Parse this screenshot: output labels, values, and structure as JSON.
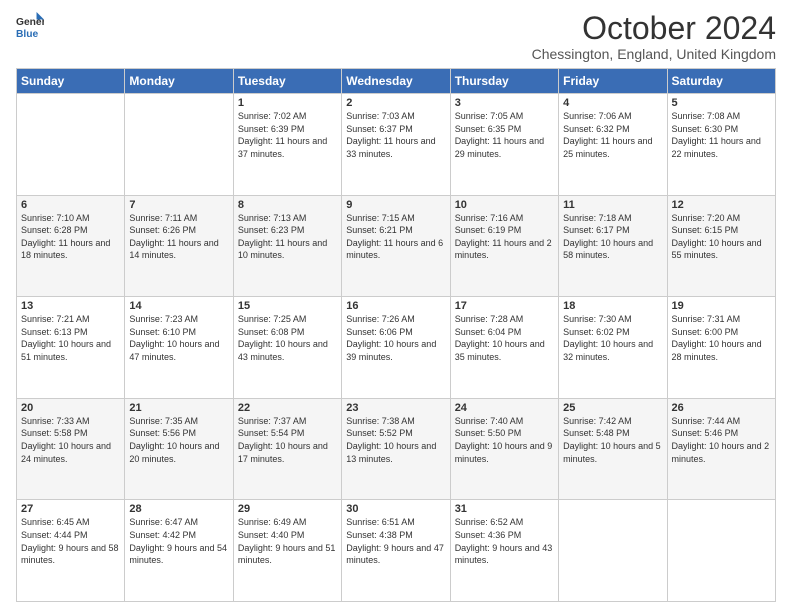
{
  "header": {
    "logo_line1": "General",
    "logo_line2": "Blue",
    "month": "October 2024",
    "location": "Chessington, England, United Kingdom"
  },
  "days_of_week": [
    "Sunday",
    "Monday",
    "Tuesday",
    "Wednesday",
    "Thursday",
    "Friday",
    "Saturday"
  ],
  "weeks": [
    [
      {
        "day": "",
        "sunrise": "",
        "sunset": "",
        "daylight": ""
      },
      {
        "day": "",
        "sunrise": "",
        "sunset": "",
        "daylight": ""
      },
      {
        "day": "1",
        "sunrise": "Sunrise: 7:02 AM",
        "sunset": "Sunset: 6:39 PM",
        "daylight": "Daylight: 11 hours and 37 minutes."
      },
      {
        "day": "2",
        "sunrise": "Sunrise: 7:03 AM",
        "sunset": "Sunset: 6:37 PM",
        "daylight": "Daylight: 11 hours and 33 minutes."
      },
      {
        "day": "3",
        "sunrise": "Sunrise: 7:05 AM",
        "sunset": "Sunset: 6:35 PM",
        "daylight": "Daylight: 11 hours and 29 minutes."
      },
      {
        "day": "4",
        "sunrise": "Sunrise: 7:06 AM",
        "sunset": "Sunset: 6:32 PM",
        "daylight": "Daylight: 11 hours and 25 minutes."
      },
      {
        "day": "5",
        "sunrise": "Sunrise: 7:08 AM",
        "sunset": "Sunset: 6:30 PM",
        "daylight": "Daylight: 11 hours and 22 minutes."
      }
    ],
    [
      {
        "day": "6",
        "sunrise": "Sunrise: 7:10 AM",
        "sunset": "Sunset: 6:28 PM",
        "daylight": "Daylight: 11 hours and 18 minutes."
      },
      {
        "day": "7",
        "sunrise": "Sunrise: 7:11 AM",
        "sunset": "Sunset: 6:26 PM",
        "daylight": "Daylight: 11 hours and 14 minutes."
      },
      {
        "day": "8",
        "sunrise": "Sunrise: 7:13 AM",
        "sunset": "Sunset: 6:23 PM",
        "daylight": "Daylight: 11 hours and 10 minutes."
      },
      {
        "day": "9",
        "sunrise": "Sunrise: 7:15 AM",
        "sunset": "Sunset: 6:21 PM",
        "daylight": "Daylight: 11 hours and 6 minutes."
      },
      {
        "day": "10",
        "sunrise": "Sunrise: 7:16 AM",
        "sunset": "Sunset: 6:19 PM",
        "daylight": "Daylight: 11 hours and 2 minutes."
      },
      {
        "day": "11",
        "sunrise": "Sunrise: 7:18 AM",
        "sunset": "Sunset: 6:17 PM",
        "daylight": "Daylight: 10 hours and 58 minutes."
      },
      {
        "day": "12",
        "sunrise": "Sunrise: 7:20 AM",
        "sunset": "Sunset: 6:15 PM",
        "daylight": "Daylight: 10 hours and 55 minutes."
      }
    ],
    [
      {
        "day": "13",
        "sunrise": "Sunrise: 7:21 AM",
        "sunset": "Sunset: 6:13 PM",
        "daylight": "Daylight: 10 hours and 51 minutes."
      },
      {
        "day": "14",
        "sunrise": "Sunrise: 7:23 AM",
        "sunset": "Sunset: 6:10 PM",
        "daylight": "Daylight: 10 hours and 47 minutes."
      },
      {
        "day": "15",
        "sunrise": "Sunrise: 7:25 AM",
        "sunset": "Sunset: 6:08 PM",
        "daylight": "Daylight: 10 hours and 43 minutes."
      },
      {
        "day": "16",
        "sunrise": "Sunrise: 7:26 AM",
        "sunset": "Sunset: 6:06 PM",
        "daylight": "Daylight: 10 hours and 39 minutes."
      },
      {
        "day": "17",
        "sunrise": "Sunrise: 7:28 AM",
        "sunset": "Sunset: 6:04 PM",
        "daylight": "Daylight: 10 hours and 35 minutes."
      },
      {
        "day": "18",
        "sunrise": "Sunrise: 7:30 AM",
        "sunset": "Sunset: 6:02 PM",
        "daylight": "Daylight: 10 hours and 32 minutes."
      },
      {
        "day": "19",
        "sunrise": "Sunrise: 7:31 AM",
        "sunset": "Sunset: 6:00 PM",
        "daylight": "Daylight: 10 hours and 28 minutes."
      }
    ],
    [
      {
        "day": "20",
        "sunrise": "Sunrise: 7:33 AM",
        "sunset": "Sunset: 5:58 PM",
        "daylight": "Daylight: 10 hours and 24 minutes."
      },
      {
        "day": "21",
        "sunrise": "Sunrise: 7:35 AM",
        "sunset": "Sunset: 5:56 PM",
        "daylight": "Daylight: 10 hours and 20 minutes."
      },
      {
        "day": "22",
        "sunrise": "Sunrise: 7:37 AM",
        "sunset": "Sunset: 5:54 PM",
        "daylight": "Daylight: 10 hours and 17 minutes."
      },
      {
        "day": "23",
        "sunrise": "Sunrise: 7:38 AM",
        "sunset": "Sunset: 5:52 PM",
        "daylight": "Daylight: 10 hours and 13 minutes."
      },
      {
        "day": "24",
        "sunrise": "Sunrise: 7:40 AM",
        "sunset": "Sunset: 5:50 PM",
        "daylight": "Daylight: 10 hours and 9 minutes."
      },
      {
        "day": "25",
        "sunrise": "Sunrise: 7:42 AM",
        "sunset": "Sunset: 5:48 PM",
        "daylight": "Daylight: 10 hours and 5 minutes."
      },
      {
        "day": "26",
        "sunrise": "Sunrise: 7:44 AM",
        "sunset": "Sunset: 5:46 PM",
        "daylight": "Daylight: 10 hours and 2 minutes."
      }
    ],
    [
      {
        "day": "27",
        "sunrise": "Sunrise: 6:45 AM",
        "sunset": "Sunset: 4:44 PM",
        "daylight": "Daylight: 9 hours and 58 minutes."
      },
      {
        "day": "28",
        "sunrise": "Sunrise: 6:47 AM",
        "sunset": "Sunset: 4:42 PM",
        "daylight": "Daylight: 9 hours and 54 minutes."
      },
      {
        "day": "29",
        "sunrise": "Sunrise: 6:49 AM",
        "sunset": "Sunset: 4:40 PM",
        "daylight": "Daylight: 9 hours and 51 minutes."
      },
      {
        "day": "30",
        "sunrise": "Sunrise: 6:51 AM",
        "sunset": "Sunset: 4:38 PM",
        "daylight": "Daylight: 9 hours and 47 minutes."
      },
      {
        "day": "31",
        "sunrise": "Sunrise: 6:52 AM",
        "sunset": "Sunset: 4:36 PM",
        "daylight": "Daylight: 9 hours and 43 minutes."
      },
      {
        "day": "",
        "sunrise": "",
        "sunset": "",
        "daylight": ""
      },
      {
        "day": "",
        "sunrise": "",
        "sunset": "",
        "daylight": ""
      }
    ]
  ]
}
